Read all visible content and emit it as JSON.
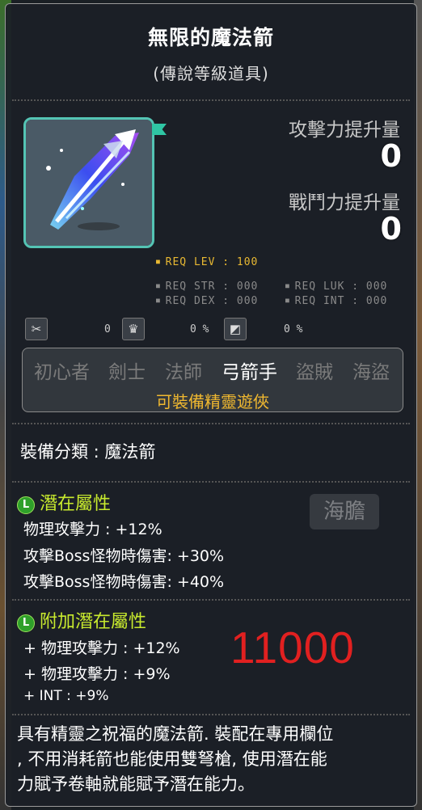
{
  "item": {
    "name": "無限的魔法箭",
    "grade": "(傳說等級道具)"
  },
  "stats": {
    "attack_label": "攻擊力提升量",
    "attack_value": "0",
    "combat_label": "戰鬥力提升量",
    "combat_value": "0"
  },
  "requirements": {
    "lev": "REQ LEV : 100",
    "str": "REQ STR : 000",
    "luk": "REQ LUK : 000",
    "dex": "REQ DEX : 000",
    "int": "REQ INT : 000"
  },
  "small_stats": [
    "0",
    "0 %",
    "0 %"
  ],
  "jobs": [
    "初心者",
    "劍士",
    "法師",
    "弓箭手",
    "盜賊",
    "海盜"
  ],
  "active_job": "弓箭手",
  "equip_note": "可裝備精靈遊俠",
  "category": "裝備分類 : 魔法箭",
  "potential": {
    "icon_letter": "L",
    "title": "潛在屬性",
    "lines": [
      "物理攻擊力 : +12%",
      "攻擊Boss怪物時傷害: +30%",
      "攻擊Boss怪物時傷害: +40%"
    ]
  },
  "bonus_potential": {
    "icon_letter": "L",
    "title": "附加潛在屬性",
    "lines": [
      "+ 物理攻擊力 : +12%",
      "+ 物理攻擊力 : +9%",
      "+ INT : +9%"
    ]
  },
  "overlay_number": "11000",
  "background_label": "海膽",
  "description": [
    "具有精靈之祝福的魔法箭. 裝配在專用欄位",
    ", 不用消耗箭也能使用雙弩槍, 使用潛在能",
    "力賦予卷軸就能賦予潛在能力。"
  ],
  "colors": {
    "req_lev": "#e8b832",
    "equip_note": "#f0b830",
    "potential_title": "#c8ea2e",
    "overlay_number": "#e12020"
  }
}
